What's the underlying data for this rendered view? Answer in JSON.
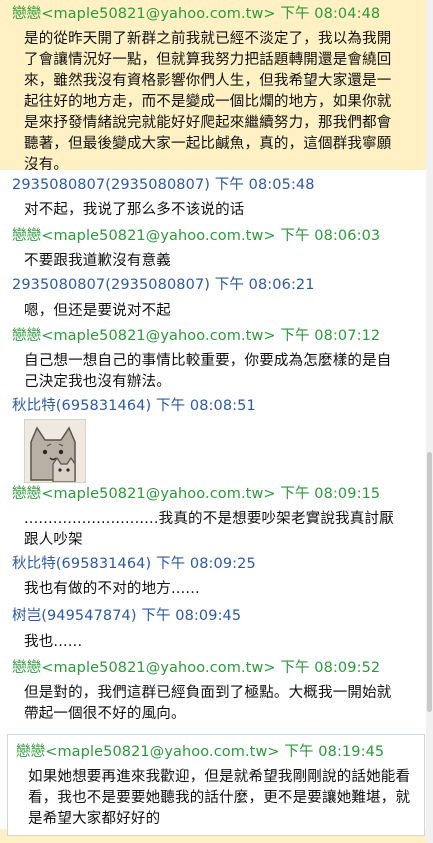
{
  "messages": [
    {
      "sender": "戀戀<maple50821@yahoo.com.tw>",
      "time": "下午 08:04:48",
      "text": "是的從昨天開了新群之前我就已經不淡定了，我以為我開了會讓情況好一點，但就算我努力把話題轉開還是會繞回來，雖然我沒有資格影響你們人生，但我希望大家還是一起往好的地方走，而不是變成一個比爛的地方，如果你就是來抒發情緒說完就能好好爬起來繼續努力，那我們都會聽著，但最後變成大家一起比鹹魚，真的，這個群我寧願沒有。"
    },
    {
      "sender": "2935080807(2935080807)",
      "time": "下午 08:05:48",
      "text": "对不起，我说了那么多不该说的话"
    },
    {
      "sender": "戀戀<maple50821@yahoo.com.tw>",
      "time": "下午 08:06:03",
      "text": "不要跟我道歉沒有意義"
    },
    {
      "sender": "2935080807(2935080807)",
      "time": "下午 08:06:21",
      "text": "嗯，但还是要说对不起"
    },
    {
      "sender": "戀戀<maple50821@yahoo.com.tw>",
      "time": "下午 08:07:12",
      "text": "自己想一想自己的事情比較重要，你要成為怎麼樣的是自己決定我也沒有辦法。"
    },
    {
      "sender": "秋比特(695831464)",
      "time": "下午 08:08:51",
      "text": ""
    },
    {
      "sender": "戀戀<maple50821@yahoo.com.tw>",
      "time": "下午 08:09:15",
      "text": "............................我真的不是想要吵架老實說我真討厭跟人吵架"
    },
    {
      "sender": "秋比特(695831464)",
      "time": "下午 08:09:25",
      "text": "我也有做的不对的地方......"
    },
    {
      "sender": "树岂(949547874)",
      "time": "下午 08:09:45",
      "text": "我也......"
    },
    {
      "sender": "戀戀<maple50821@yahoo.com.tw>",
      "time": "下午 08:09:52",
      "text": "但是對的，我們這群已經負面到了極點。大概我一開始就帶起一個很不好的風向。"
    }
  ],
  "compose": {
    "sender": "戀戀<maple50821@yahoo.com.tw>",
    "time": "下午 08:19:45",
    "text": "如果她想要再進來我歡迎，但是就希望我剛剛說的話她能看看，我也不是要要她聽我的話什麼，更不是要讓她難堪，就是希望大家都好好的"
  },
  "colors": {
    "sender_self": "#2b9a3a",
    "sender_other": "#2c5aa8",
    "highlight": "#fff1c3"
  }
}
